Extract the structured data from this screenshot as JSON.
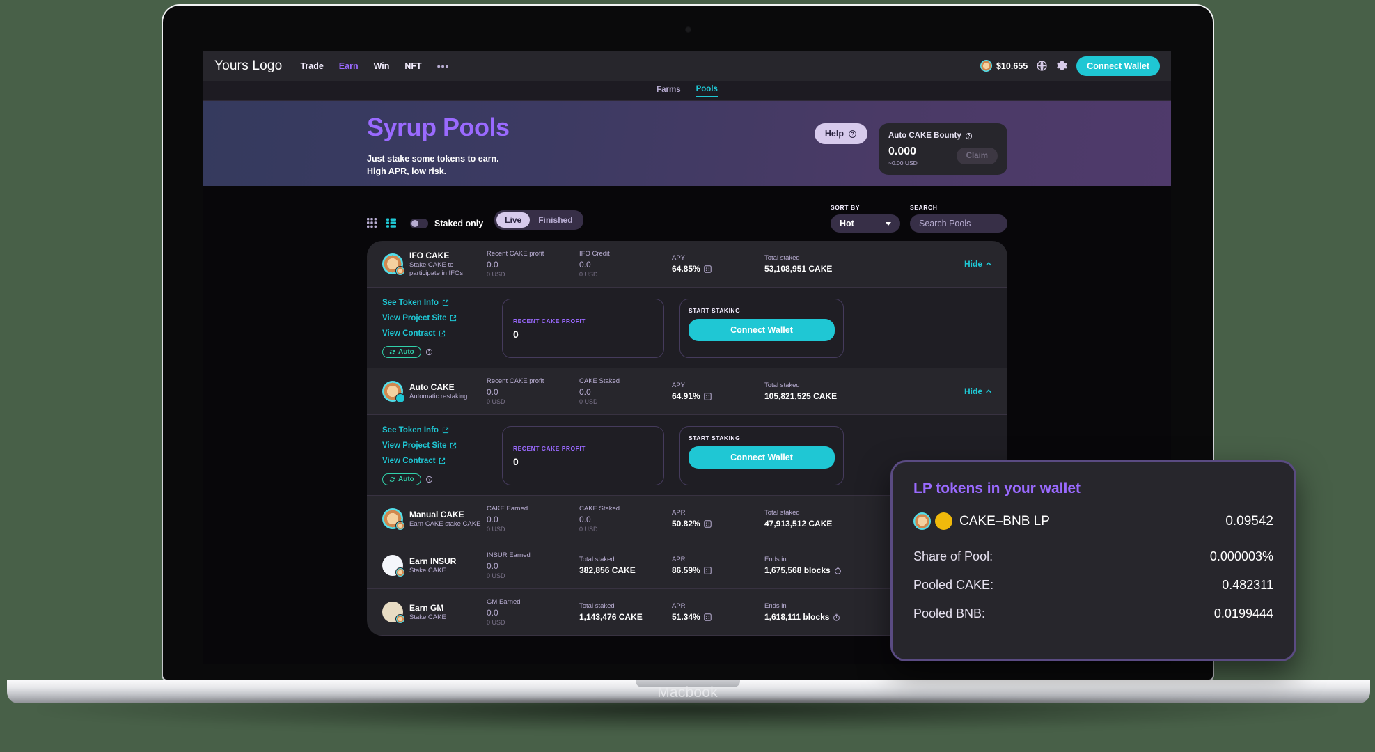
{
  "device": {
    "label": "Macbook"
  },
  "topnav": {
    "brand": "Yours Logo",
    "links": [
      {
        "label": "Trade",
        "active": false
      },
      {
        "label": "Earn",
        "active": true
      },
      {
        "label": "Win",
        "active": false
      },
      {
        "label": "NFT",
        "active": false
      },
      {
        "label": "•••",
        "active": false
      }
    ],
    "price": "$10.655",
    "price_icon": "cake-token-icon",
    "language_icon": "globe-icon",
    "settings_icon": "gear-icon",
    "connect_label": "Connect Wallet"
  },
  "subnav": {
    "tabs": [
      {
        "label": "Farms",
        "active": false
      },
      {
        "label": "Pools",
        "active": true
      }
    ]
  },
  "hero": {
    "title": "Syrup Pools",
    "subtitle_line1": "Just stake some tokens to earn.",
    "subtitle_line2": "High APR, low risk.",
    "help_label": "Help",
    "help_icon": "question-circle-icon",
    "bounty": {
      "title": "Auto CAKE Bounty",
      "info_icon": "question-circle-icon",
      "amount": "0.000",
      "usd": "~0.00 USD",
      "claim_label": "Claim"
    }
  },
  "toolbar": {
    "grid_view_icon": "grid-view-icon",
    "list_view_icon": "list-view-icon",
    "staked_only_label": "Staked only",
    "staked_only_on": false,
    "segments": [
      {
        "label": "Live",
        "active": true
      },
      {
        "label": "Finished",
        "active": false
      }
    ],
    "sort_label": "SORT BY",
    "sort_value": "Hot",
    "search_label": "SEARCH",
    "search_placeholder": "Search Pools",
    "search_value": ""
  },
  "pools": [
    {
      "name": "IFO CAKE",
      "desc_line1": "Stake CAKE to",
      "desc_line2": "participate in IFOs",
      "avatar_main": "cake-token-icon",
      "avatar_sub": "cake-token-icon",
      "columns": [
        {
          "label": "Recent CAKE profit",
          "value": "0.0",
          "usd": "0 USD",
          "dim": true
        },
        {
          "label": "IFO Credit",
          "value": "0.0",
          "usd": "0 USD",
          "dim": true
        },
        {
          "label": "APY",
          "value": "64.85%",
          "calc_icon": "calculator-icon"
        },
        {
          "label": "Total staked",
          "value": "53,108,951 CAKE"
        }
      ],
      "hide_label": "Hide",
      "hide_icon": "chevron-up-icon",
      "expanded": {
        "links": [
          {
            "label": "See Token Info",
            "icon": "external-link-icon"
          },
          {
            "label": "View Project Site",
            "icon": "external-link-icon"
          },
          {
            "label": "View Contract",
            "icon": "external-link-icon"
          }
        ],
        "auto_badge": "Auto",
        "auto_icon": "refresh-icon",
        "auto_info_icon": "question-circle-icon",
        "profit_label": "RECENT CAKE PROFIT",
        "profit_value": "0",
        "stake_label": "START STAKING",
        "stake_button": "Connect Wallet"
      }
    },
    {
      "name": "Auto CAKE",
      "desc_line1": "Automatic restaking",
      "desc_line2": "",
      "avatar_main": "cake-token-icon",
      "avatar_sub": "auto-refresh-icon",
      "columns": [
        {
          "label": "Recent CAKE profit",
          "value": "0.0",
          "usd": "0 USD",
          "dim": true
        },
        {
          "label": "CAKE Staked",
          "value": "0.0",
          "usd": "0 USD",
          "dim": true
        },
        {
          "label": "APY",
          "value": "64.91%",
          "calc_icon": "calculator-icon"
        },
        {
          "label": "Total staked",
          "value": "105,821,525 CAKE"
        }
      ],
      "hide_label": "Hide",
      "hide_icon": "chevron-up-icon",
      "expanded": {
        "links": [
          {
            "label": "See Token Info",
            "icon": "external-link-icon"
          },
          {
            "label": "View Project Site",
            "icon": "external-link-icon"
          },
          {
            "label": "View Contract",
            "icon": "external-link-icon"
          }
        ],
        "auto_badge": "Auto",
        "auto_icon": "refresh-icon",
        "auto_info_icon": "question-circle-icon",
        "profit_label": "RECENT CAKE PROFIT",
        "profit_value": "0",
        "stake_label": "START STAKING",
        "stake_button": "Connect Wallet"
      }
    },
    {
      "name": "Manual CAKE",
      "desc_line1": "Earn CAKE stake CAKE",
      "desc_line2": "",
      "avatar_main": "cake-token-icon",
      "avatar_sub": "cake-token-icon",
      "columns": [
        {
          "label": "CAKE Earned",
          "value": "0.0",
          "usd": "0 USD",
          "dim": true
        },
        {
          "label": "CAKE Staked",
          "value": "0.0",
          "usd": "0 USD",
          "dim": true
        },
        {
          "label": "APR",
          "value": "50.82%",
          "calc_icon": "calculator-icon"
        },
        {
          "label": "Total staked",
          "value": "47,913,512 CAKE"
        }
      ],
      "hide_label": "",
      "hide_icon": ""
    },
    {
      "name": "Earn INSUR",
      "desc_line1": "Stake CAKE",
      "desc_line2": "",
      "avatar_main": "insur-token-icon",
      "avatar_sub": "cake-token-icon",
      "columns": [
        {
          "label": "INSUR Earned",
          "value": "0.0",
          "usd": "0 USD",
          "dim": true
        },
        {
          "label": "Total staked",
          "value": "382,856 CAKE"
        },
        {
          "label": "APR",
          "value": "86.59%",
          "calc_icon": "calculator-icon"
        },
        {
          "label": "Ends in",
          "value": "1,675,568 blocks",
          "timer_icon": "timer-icon"
        }
      ],
      "hide_label": "",
      "hide_icon": ""
    },
    {
      "name": "Earn GM",
      "desc_line1": "Stake CAKE",
      "desc_line2": "",
      "avatar_main": "gm-token-icon",
      "avatar_sub": "cake-token-icon",
      "columns": [
        {
          "label": "GM Earned",
          "value": "0.0",
          "usd": "0 USD",
          "dim": true
        },
        {
          "label": "Total staked",
          "value": "1,143,476 CAKE"
        },
        {
          "label": "APR",
          "value": "51.34%",
          "calc_icon": "calculator-icon"
        },
        {
          "label": "Ends in",
          "value": "1,618,111 blocks",
          "timer_icon": "timer-icon"
        }
      ],
      "hide_label": "",
      "hide_icon": ""
    }
  ],
  "lp_popup": {
    "title": "LP tokens in your wallet",
    "pair_name": "CAKE–BNB LP",
    "pair_value": "0.09542",
    "pair_icon_1": "cake-token-icon",
    "pair_icon_2": "bnb-token-icon",
    "rows": [
      {
        "key": "Share of Pool:",
        "value": "0.000003%"
      },
      {
        "key": "Pooled CAKE:",
        "value": "0.482311"
      },
      {
        "key": "Pooled BNB:",
        "value": "0.0199444"
      }
    ]
  },
  "colors": {
    "accent_cyan": "#1fc7d4",
    "accent_purple": "#9a6aff",
    "card_bg": "#27262c",
    "text_secondary": "#b8add2",
    "success_green": "#31d0aa"
  }
}
